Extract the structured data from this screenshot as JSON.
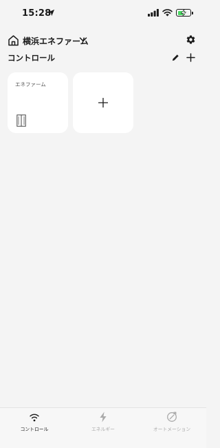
{
  "status_bar": {
    "time": "15:28",
    "battery_level": 0.6,
    "battery_charging": true,
    "colors": {
      "battery_fill": "#4cd964"
    }
  },
  "header": {
    "home_icon": "home-icon",
    "title": "横浜エネファーム",
    "chevron_icon": "chevron-down-icon",
    "settings_icon": "gear-icon"
  },
  "section": {
    "title": "コントロール",
    "edit_icon": "pencil-icon",
    "add_icon": "plus-icon"
  },
  "cards": [
    {
      "label": "エネファーム",
      "icon": "fuel-cell-device-icon"
    },
    {
      "label": "",
      "icon": "plus-icon"
    }
  ],
  "tab_bar": {
    "tabs": [
      {
        "label": "コントロール",
        "icon": "wifi-icon",
        "active": true
      },
      {
        "label": "エネルギー",
        "icon": "lightning-bolt-icon",
        "active": false
      },
      {
        "label": "オートメーション",
        "icon": "automation-icon",
        "active": false
      }
    ],
    "colors": {
      "active": "#1a1a1a",
      "inactive": "#aaaaaa"
    }
  }
}
